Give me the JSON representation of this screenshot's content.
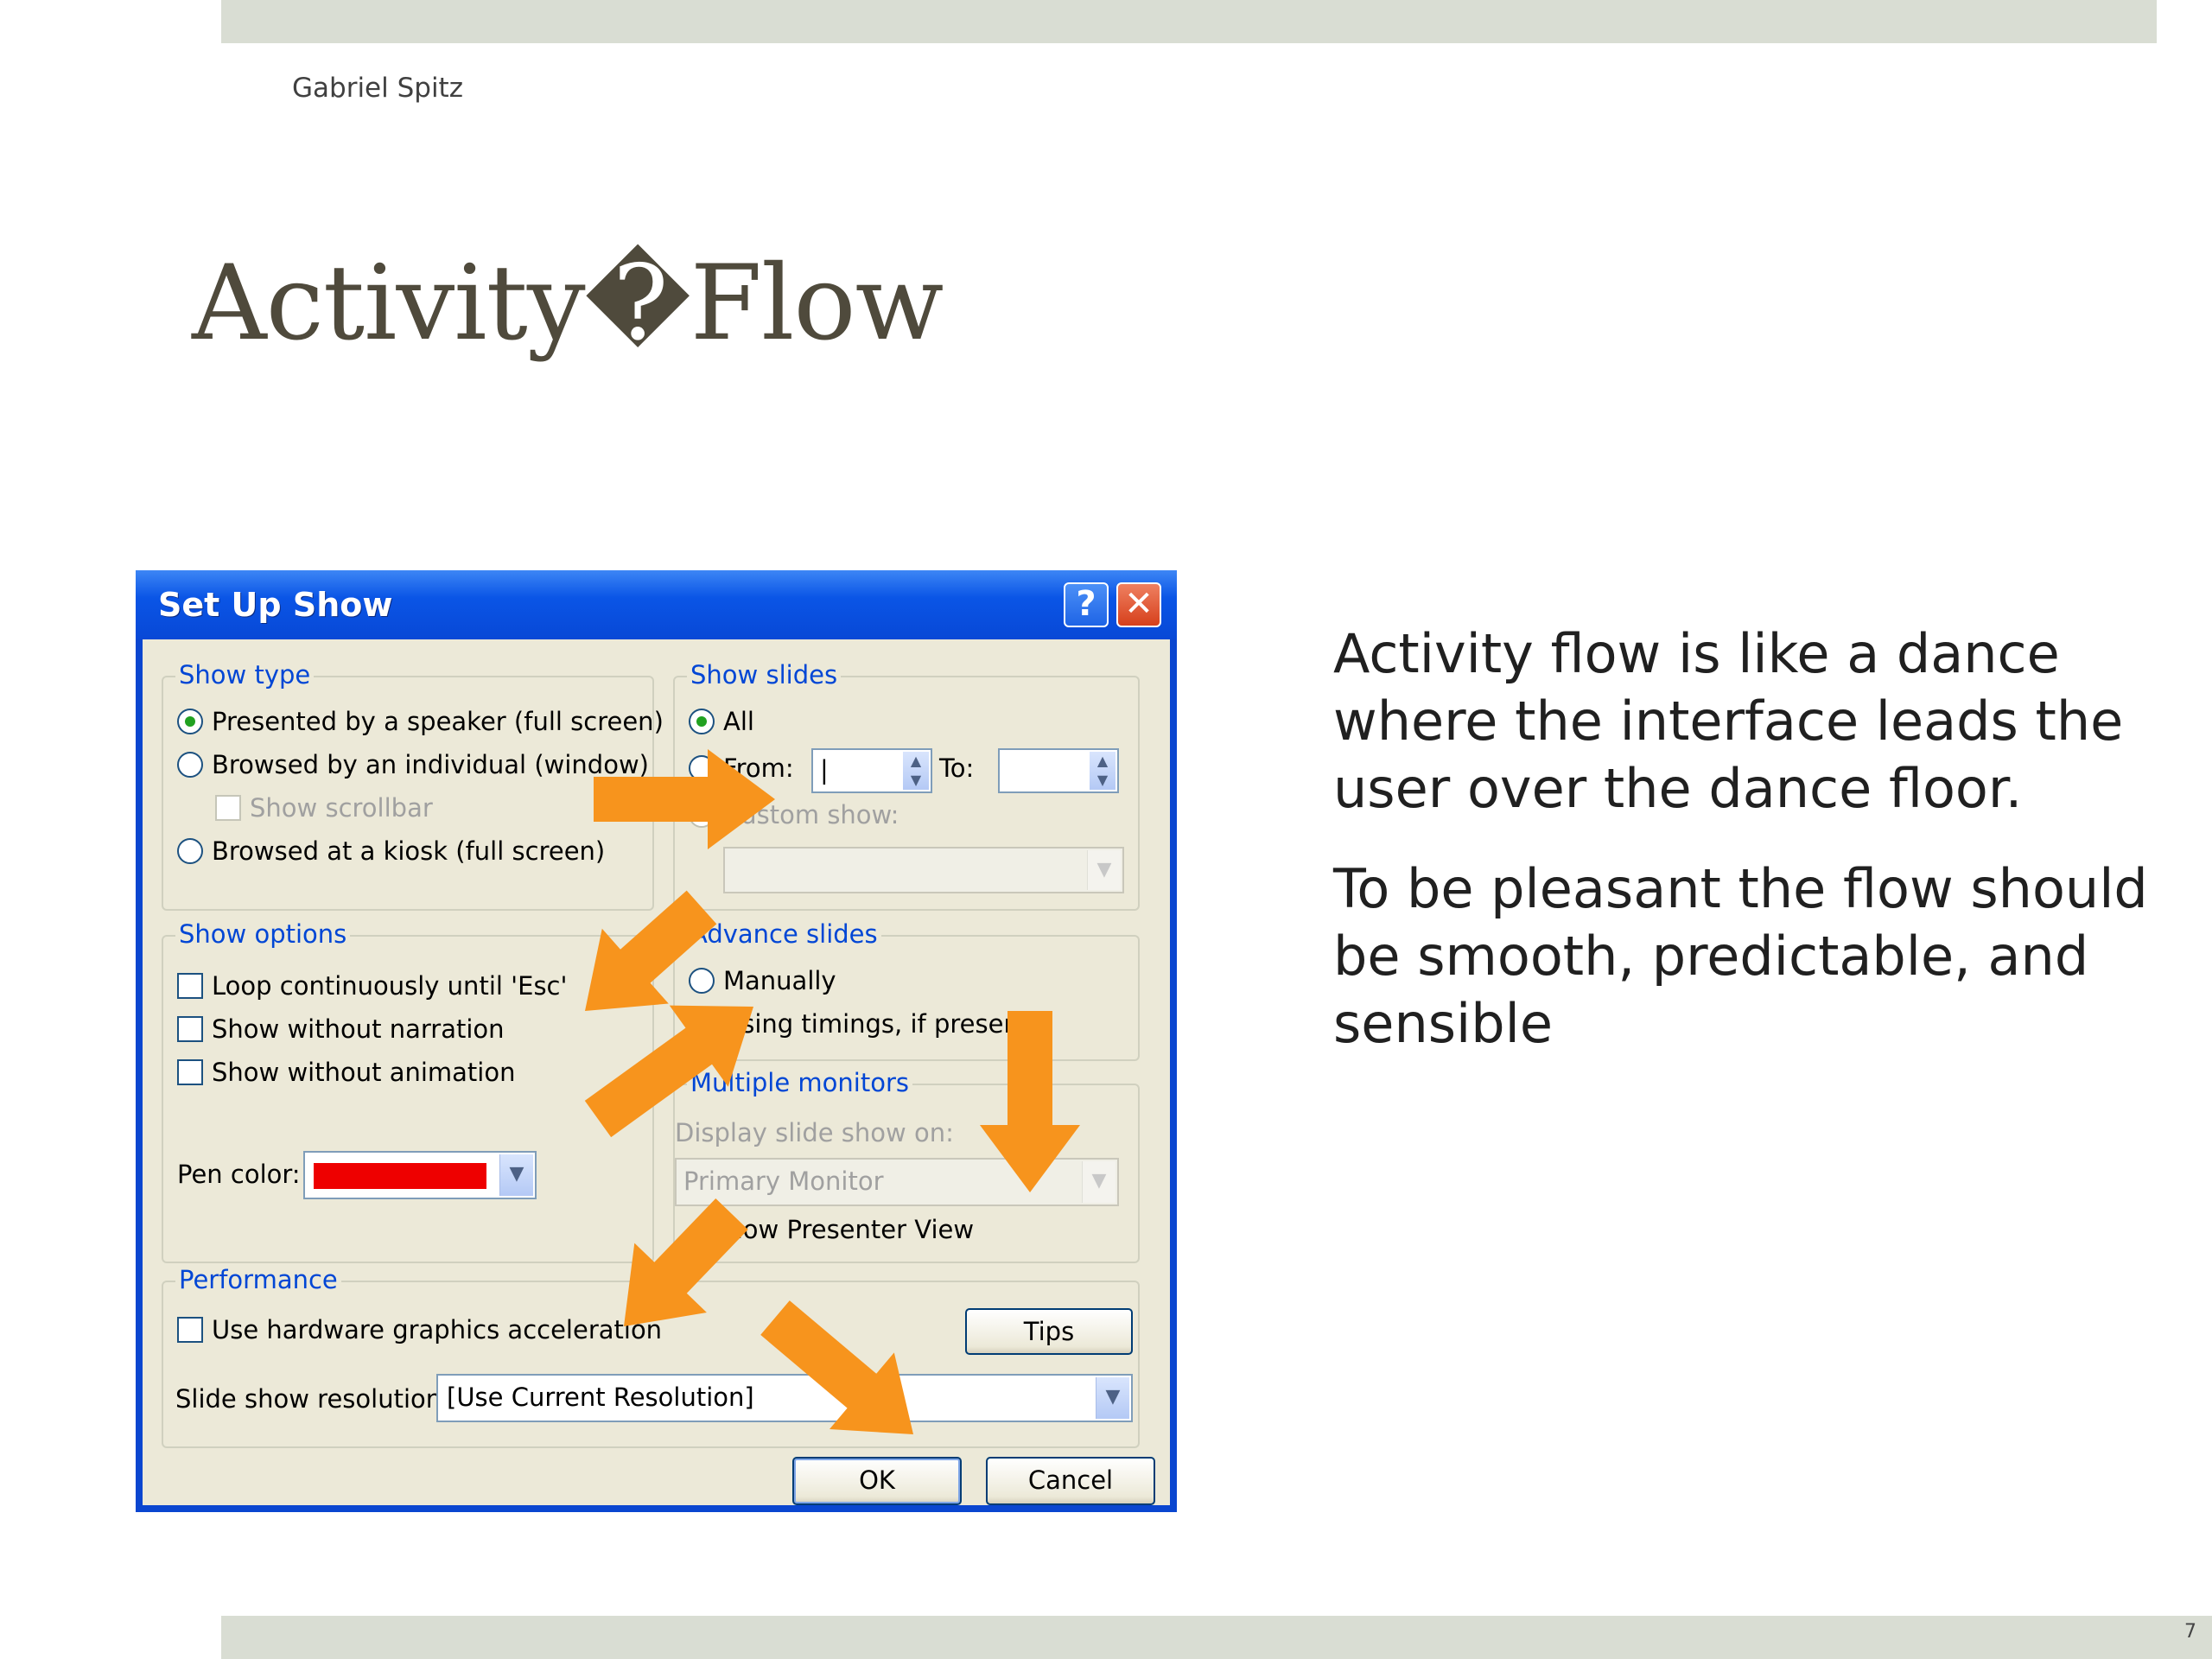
{
  "slide": {
    "author": "Gabriel Spitz",
    "title": "Activity�Flow",
    "page_number": "7",
    "paragraphs": [
      "Activity flow is like a dance where the interface leads the user over the dance floor.",
      "To be pleasant the flow should be smooth, predictable, and sensible"
    ]
  },
  "dialog": {
    "title": "Set Up Show",
    "help_button": "?",
    "close_button": "✕",
    "show_type": {
      "label": "Show type",
      "options": [
        "Presented by a speaker (full screen)",
        "Browsed by an individual (window)",
        "Browsed at a kiosk (full screen)"
      ],
      "selected": 0,
      "show_scrollbar": "Show scrollbar"
    },
    "show_slides": {
      "label": "Show slides",
      "all": "All",
      "from": "From:",
      "to": "To:",
      "from_value": "|",
      "to_value": "",
      "custom_show": "Custom show:"
    },
    "show_options": {
      "label": "Show options",
      "loop": "Loop continuously until 'Esc'",
      "no_narration": "Show without narration",
      "no_animation": "Show without animation",
      "pen_color_label": "Pen color:",
      "pen_color": "#ee0000"
    },
    "advance_slides": {
      "label": "Advance slides",
      "manually": "Manually",
      "timings": "Using timings, if present",
      "selected": 1
    },
    "multiple_monitors": {
      "label": "Multiple monitors",
      "display_on": "Display slide show on:",
      "monitor_value": "Primary Monitor",
      "presenter_view": "Show Presenter View"
    },
    "performance": {
      "label": "Performance",
      "hw_accel": "Use hardware graphics acceleration",
      "tips": "Tips",
      "resolution_label": "Slide show resolution:",
      "resolution_value": "[Use Current Resolution]"
    },
    "ok": "OK",
    "cancel": "Cancel"
  },
  "colors": {
    "arrow": "#f7941d",
    "title": "#4f4a3c",
    "band": "#d9ddd3",
    "xp_blue": "#0a46d0",
    "dialog_face": "#ece9d8",
    "group_label": "#0046d5"
  }
}
